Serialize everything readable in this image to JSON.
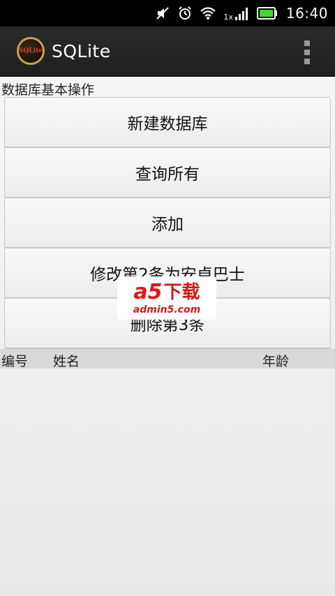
{
  "status_bar": {
    "time": "16:40",
    "network_label": "1x",
    "icons": [
      "mute-icon",
      "alarm-icon",
      "wifi-icon",
      "signal-icon",
      "battery-icon"
    ]
  },
  "action_bar": {
    "title": "SQLite",
    "logo_text": "SQLite"
  },
  "section_label": "数据库基本操作",
  "buttons": [
    {
      "label": "新建数据库"
    },
    {
      "label": "查询所有"
    },
    {
      "label": "添加"
    },
    {
      "label": "修改第2条为安卓巴士"
    },
    {
      "label": "删除第3条"
    }
  ],
  "table": {
    "columns": [
      "编号",
      "姓名",
      "年龄"
    ]
  },
  "watermark": {
    "brand": "a5",
    "brand_cn": "下载",
    "url": "admin5.com"
  },
  "colors": {
    "status_bar_bg": "#000000",
    "action_bar_bg": "#222222",
    "button_bg": "#f2f2f2",
    "table_header_bg": "#d9d9d9",
    "battery_green": "#4cd137",
    "watermark_red": "#e01818"
  }
}
